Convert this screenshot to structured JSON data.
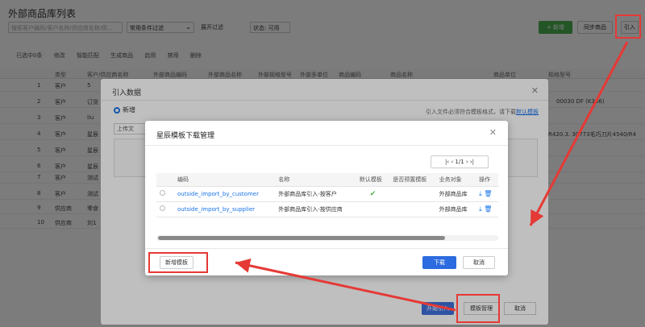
{
  "page": {
    "title": "外部商品库列表",
    "search_placeholder": "搜索客户编码/客户名称/供应商名称/供...",
    "filter_label": "常用条件过滤",
    "expand_label": "展开过滤",
    "status_label": "状态: 可用",
    "new_label": "+ 新增",
    "sync_label": "同步商品",
    "import_label": "引入"
  },
  "toolbar": {
    "selected": "已选中0条",
    "edit": "修改",
    "smart_match": "智能匹配",
    "generate": "生成商品",
    "enable": "启用",
    "disable": "禁用",
    "delete": "删除"
  },
  "grid": {
    "headers": [
      "类型",
      "客户/供应商名称",
      "外部商品编码",
      "外部商品名称",
      "外部规格型号",
      "外部多单位",
      "商品编码",
      "商品名称",
      "商品单位",
      "规格型号"
    ],
    "rows": [
      {
        "num": "1",
        "type": "客户",
        "name": "5"
      },
      {
        "num": "2",
        "type": "客户",
        "name": "订货"
      },
      {
        "num": "3",
        "type": "客户",
        "name": "liu"
      },
      {
        "num": "4",
        "type": "客户",
        "name": "星辰"
      },
      {
        "num": "5",
        "type": "客户",
        "name": "星辰"
      },
      {
        "num": "6",
        "type": "客户",
        "name": "星辰"
      },
      {
        "num": "7",
        "type": "客户",
        "name": "测试"
      },
      {
        "num": "8",
        "type": "客户",
        "name": "测试"
      },
      {
        "num": "9",
        "type": "供应商",
        "name": "零食"
      },
      {
        "num": "10",
        "type": "供应商",
        "name": "刘1"
      }
    ],
    "right_texts": [
      "00030 DF (K366)",
      "R420.3. 30773毛巧刀片4540/R4"
    ]
  },
  "import_dialog": {
    "title": "引入数据",
    "radio_new": "新增",
    "hint": "引入文件必须符合模板格式，请下载",
    "hint_link": "默认模板",
    "upload": "上传文",
    "start_import": "开始引入",
    "template_manage": "模板管理",
    "cancel": "取消"
  },
  "template_dialog": {
    "title": "星辰模板下载管理",
    "pager": "1/1",
    "columns": [
      "编码",
      "名称",
      "默认模板",
      "是否预置模板",
      "业务对象",
      "操作"
    ],
    "rows": [
      {
        "code": "outside_import_by_customer",
        "name": "外部商品库引入-按客户",
        "default": "✔",
        "preset": "",
        "object": "外部商品库"
      },
      {
        "code": "outside_import_by_supplier",
        "name": "外部商品库引入-按供应商",
        "default": "",
        "preset": "",
        "object": "外部商品库"
      }
    ],
    "new_template": "新增模板",
    "download": "下载",
    "cancel": "取消"
  },
  "colors": {
    "accent": "#2c6be0",
    "success": "#4caf50",
    "highlight": "#e53935"
  }
}
